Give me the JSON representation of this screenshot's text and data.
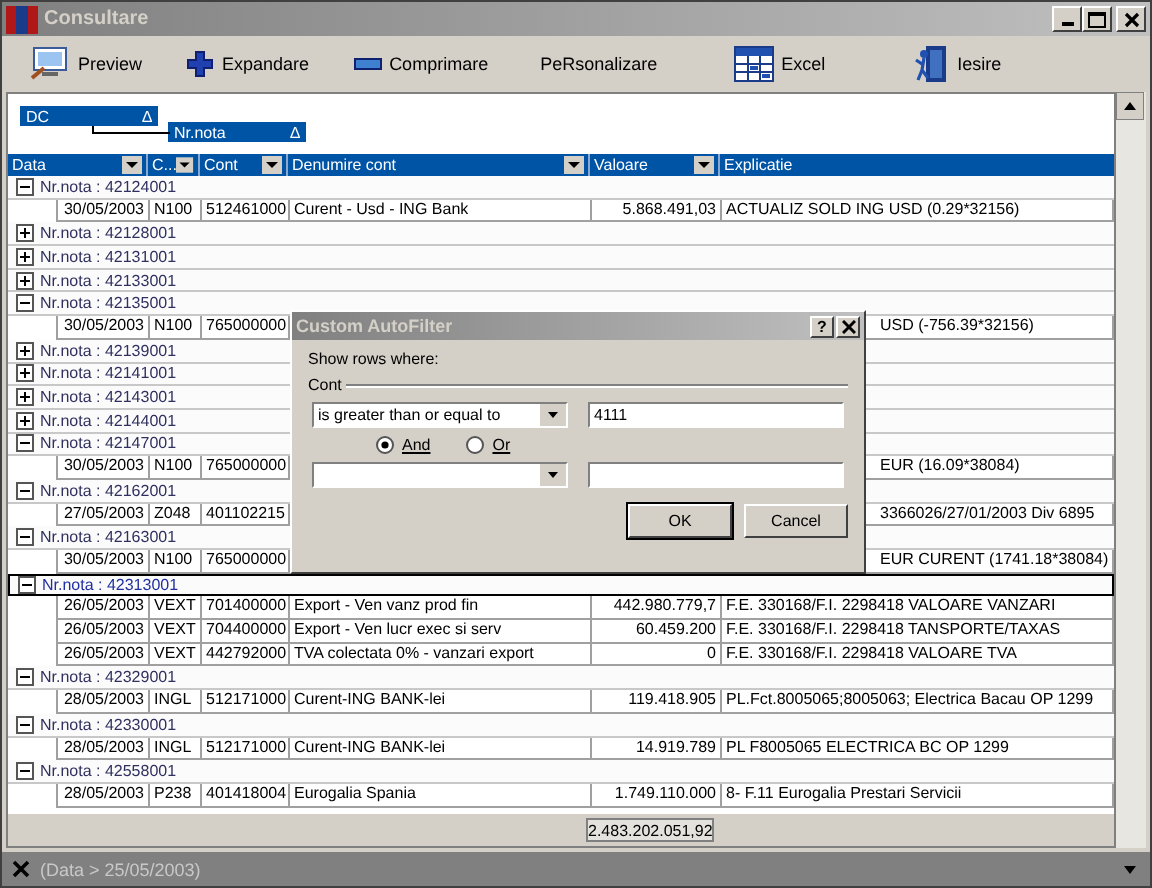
{
  "window": {
    "title": "Consultare"
  },
  "toolbar": [
    {
      "kind": "preview",
      "label": "Preview"
    },
    {
      "kind": "expand",
      "label": "Expandare"
    },
    {
      "kind": "collapse",
      "label": "Comprimare"
    },
    {
      "kind": "none",
      "label": "PeRsonalizare"
    },
    {
      "kind": "excel",
      "label": "Excel"
    },
    {
      "kind": "exit",
      "label": "Iesire"
    }
  ],
  "group_panel": [
    {
      "label": "DC",
      "sort_mark": "∆"
    },
    {
      "label": "Nr.nota",
      "sort_mark": "∆"
    }
  ],
  "columns": [
    "Data",
    "C...",
    "Cont",
    "Denumire cont",
    "Valoare",
    "Explicatie"
  ],
  "rows": [
    {
      "kind": "group",
      "label": "Nr.nota : 42124001",
      "expanded": true,
      "selected": false
    },
    {
      "kind": "detail",
      "data": "30/05/2003",
      "c": "N100",
      "cont": "512461000",
      "denumire": "Curent - Usd - ING Bank",
      "valoare": "5.868.491,03",
      "explicatie": "ACTUALIZ SOLD ING USD (0.29*32156)",
      "under_dialog": false
    },
    {
      "kind": "group",
      "label": "Nr.nota : 42128001",
      "expanded": false,
      "selected": false
    },
    {
      "kind": "group",
      "label": "Nr.nota : 42131001",
      "expanded": false,
      "selected": false
    },
    {
      "kind": "group",
      "label": "Nr.nota : 42133001",
      "expanded": false,
      "selected": false
    },
    {
      "kind": "group",
      "label": "Nr.nota : 42135001",
      "expanded": true,
      "selected": false
    },
    {
      "kind": "detail",
      "data": "30/05/2003",
      "c": "N100",
      "cont": "765000000",
      "explicatie": "USD (-756.39*32156)",
      "under_dialog": true
    },
    {
      "kind": "group",
      "label": "Nr.nota : 42139001",
      "expanded": false,
      "selected": false
    },
    {
      "kind": "group",
      "label": "Nr.nota : 42141001",
      "expanded": false,
      "selected": false
    },
    {
      "kind": "group",
      "label": "Nr.nota : 42143001",
      "expanded": false,
      "selected": false
    },
    {
      "kind": "group",
      "label": "Nr.nota : 42144001",
      "expanded": false,
      "selected": false
    },
    {
      "kind": "group",
      "label": "Nr.nota : 42147001",
      "expanded": true,
      "selected": false
    },
    {
      "kind": "detail",
      "data": "30/05/2003",
      "c": "N100",
      "cont": "765000000",
      "explicatie": "EUR (16.09*38084)",
      "under_dialog": true
    },
    {
      "kind": "group",
      "label": "Nr.nota : 42162001",
      "expanded": true,
      "selected": false
    },
    {
      "kind": "detail",
      "data": "27/05/2003",
      "c": "Z048",
      "cont": "401102215",
      "explicatie": "3366026/27/01/2003 Div 6895",
      "under_dialog": true
    },
    {
      "kind": "group",
      "label": "Nr.nota : 42163001",
      "expanded": true,
      "selected": false
    },
    {
      "kind": "detail",
      "data": "30/05/2003",
      "c": "N100",
      "cont": "765000000",
      "explicatie": "EUR CURENT (1741.18*38084)",
      "under_dialog": true
    },
    {
      "kind": "group",
      "label": "Nr.nota : 42313001",
      "expanded": true,
      "selected": true
    },
    {
      "kind": "detail",
      "data": "26/05/2003",
      "c": "VEXT",
      "cont": "701400000",
      "denumire": "Export - Ven vanz prod fin",
      "valoare": "442.980.779,7",
      "explicatie": "F.E. 330168/F.I. 2298418 VALOARE VANZARI",
      "under_dialog": false
    },
    {
      "kind": "detail",
      "data": "26/05/2003",
      "c": "VEXT",
      "cont": "704400000",
      "denumire": "Export - Ven lucr exec si serv",
      "valoare": "60.459.200",
      "explicatie": "F.E. 330168/F.I. 2298418   TANSPORTE/TAXAS",
      "under_dialog": false
    },
    {
      "kind": "detail",
      "data": "26/05/2003",
      "c": "VEXT",
      "cont": "442792000",
      "denumire": "TVA  colectata 0% -  vanzari export",
      "valoare": "0",
      "explicatie": "F.E. 330168/F.I. 2298418 VALOARE TVA",
      "under_dialog": false
    },
    {
      "kind": "group",
      "label": "Nr.nota : 42329001",
      "expanded": true,
      "selected": false
    },
    {
      "kind": "detail",
      "data": "28/05/2003",
      "c": "INGL",
      "cont": "512171000",
      "denumire": "Curent-ING BANK-lei",
      "valoare": "119.418.905",
      "explicatie": "PL.Fct.8005065;8005063; Electrica Bacau OP 1299",
      "under_dialog": false
    },
    {
      "kind": "group",
      "label": "Nr.nota : 42330001",
      "expanded": true,
      "selected": false
    },
    {
      "kind": "detail",
      "data": "28/05/2003",
      "c": "INGL",
      "cont": "512171000",
      "denumire": "Curent-ING BANK-lei",
      "valoare": "14.919.789",
      "explicatie": "PL F8005065 ELECTRICA BC OP 1299",
      "under_dialog": false
    },
    {
      "kind": "group",
      "label": "Nr.nota : 42558001",
      "expanded": true,
      "selected": false
    },
    {
      "kind": "detail",
      "data": "28/05/2003",
      "c": "P238",
      "cont": "401418004",
      "denumire": "Eurogalia Spania",
      "valoare": "1.749.110.000",
      "explicatie": "8- F.11 Eurogalia Prestari Servicii",
      "under_dialog": false
    }
  ],
  "footer": {
    "total": "2.483.202.051,92"
  },
  "status_bar": {
    "filter": "(Data > 25/05/2003)"
  },
  "dialog": {
    "title": "Custom AutoFilter",
    "help": "?",
    "prompt": "Show rows where:",
    "group": "Cont",
    "condition_1": {
      "operator": "is greater than or equal to",
      "value": "4111"
    },
    "logic": [
      {
        "label": "And",
        "selected": true
      },
      {
        "label": "Or",
        "selected": false
      }
    ],
    "buttons": [
      "OK",
      "Cancel"
    ]
  }
}
